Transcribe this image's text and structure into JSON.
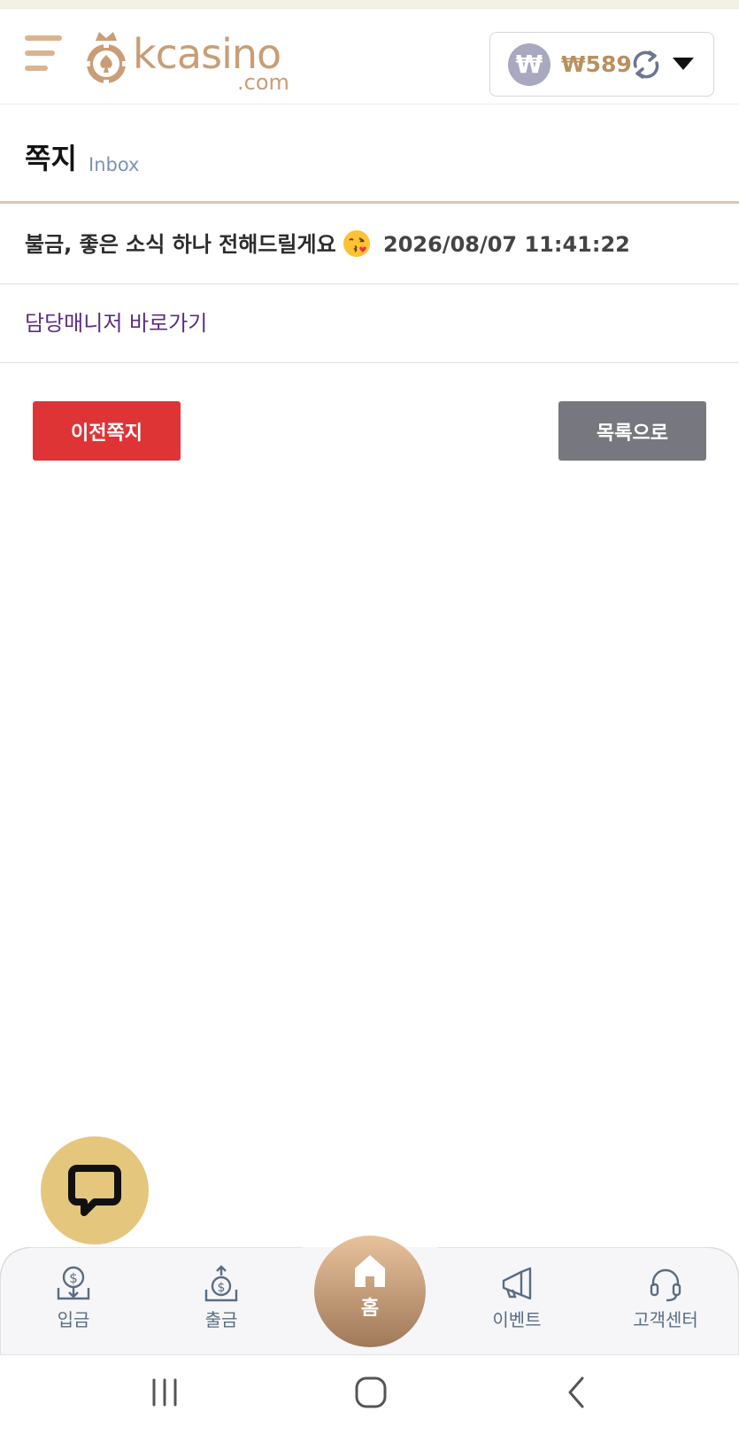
{
  "header": {
    "logo_text": "kcasino",
    "logo_sub": ".com",
    "currency_badge": "₩",
    "balance": "₩589"
  },
  "page": {
    "title": "쪽지",
    "subtitle": "Inbox"
  },
  "message": {
    "subject": "불금, 좋은 소식 하나 전해드릴게요",
    "date": "2026/08/07 11:41:22",
    "link_text": "담당매니저 바로가기"
  },
  "actions": {
    "prev_label": "이전쪽지",
    "list_label": "목록으로"
  },
  "bottom_nav": {
    "deposit": "입금",
    "withdraw": "출금",
    "home": "홈",
    "event": "이벤트",
    "support": "고객센터"
  },
  "colors": {
    "brand": "#c99e76",
    "prev_button": "#de3436",
    "list_button": "#76777f",
    "link": "#5b2d82",
    "chat_fab": "#e5c67d"
  }
}
